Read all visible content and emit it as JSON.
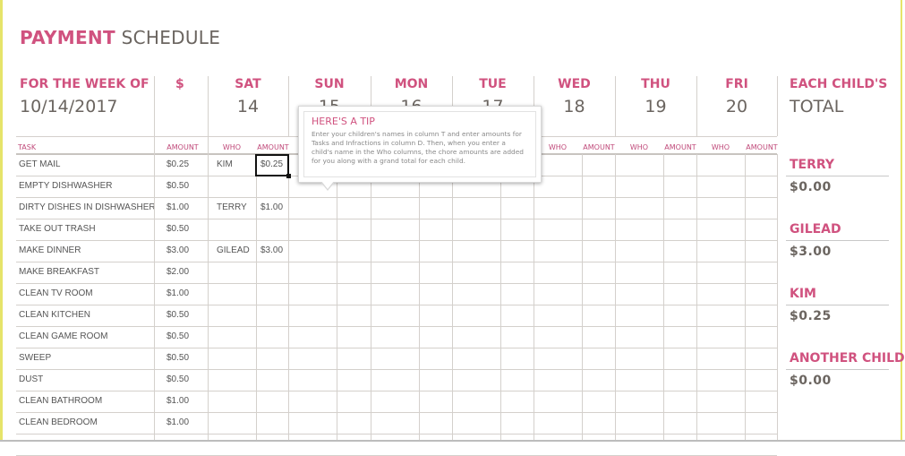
{
  "title": {
    "bold": "PAYMENT",
    "rest": "SCHEDULE"
  },
  "week": {
    "label": "FOR THE WEEK OF",
    "date": "10/14/2017"
  },
  "dollar_header": "$",
  "days": [
    {
      "name": "SAT",
      "date": "14"
    },
    {
      "name": "SUN",
      "date": "15"
    },
    {
      "name": "MON",
      "date": "16"
    },
    {
      "name": "TUE",
      "date": "17"
    },
    {
      "name": "WED",
      "date": "18"
    },
    {
      "name": "THU",
      "date": "19"
    },
    {
      "name": "FRI",
      "date": "20"
    }
  ],
  "columns": {
    "task": "TASK",
    "amount": "AMOUNT",
    "who": "WHO"
  },
  "tasks": [
    {
      "task": "GET MAIL",
      "amount": "$0.25",
      "sat_who": "KIM",
      "sat_amount": "$0.25"
    },
    {
      "task": "EMPTY DISHWASHER",
      "amount": "$0.50"
    },
    {
      "task": "DIRTY DISHES IN DISHWASHER",
      "amount": "$1.00",
      "sat_who": "TERRY",
      "sat_amount": "$1.00"
    },
    {
      "task": "TAKE OUT TRASH",
      "amount": "$0.50"
    },
    {
      "task": "MAKE DINNER",
      "amount": "$3.00",
      "sat_who": "GILEAD",
      "sat_amount": "$3.00"
    },
    {
      "task": "MAKE BREAKFAST",
      "amount": "$2.00"
    },
    {
      "task": "CLEAN TV ROOM",
      "amount": "$1.00"
    },
    {
      "task": "CLEAN KITCHEN",
      "amount": "$0.50"
    },
    {
      "task": "CLEAN GAME ROOM",
      "amount": "$0.50"
    },
    {
      "task": "SWEEP",
      "amount": "$0.50"
    },
    {
      "task": "DUST",
      "amount": "$0.50"
    },
    {
      "task": "CLEAN BATHROOM",
      "amount": "$1.00"
    },
    {
      "task": "CLEAN BEDROOM",
      "amount": "$1.00"
    }
  ],
  "totals": {
    "label1": "EACH CHILD'S",
    "label2": "TOTAL",
    "children": [
      {
        "name": "TERRY",
        "total": "$0.00"
      },
      {
        "name": "GILEAD",
        "total": "$3.00"
      },
      {
        "name": "KIM",
        "total": "$0.25"
      },
      {
        "name": "ANOTHER CHILD",
        "total": "$0.00"
      }
    ]
  },
  "tip": {
    "title": "HERE'S A TIP",
    "text": "Enter your children's names in column T and enter amounts for Tasks and Infractions in column D. Then, when you enter a child's name in the Who columns, the chore amounts are added for you along with a grand total for each child."
  },
  "colors": {
    "accent": "#d0527f",
    "text": "#6b6560",
    "grid": "#d4d0cc",
    "border": "#e6e46a"
  }
}
